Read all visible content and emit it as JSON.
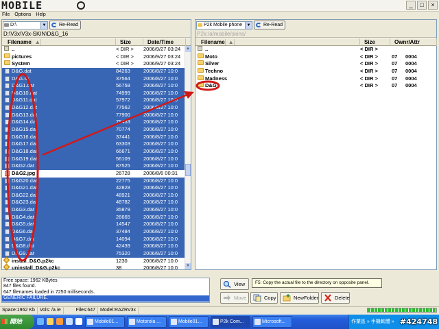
{
  "app": {
    "logo_text": "MOBILE",
    "window_buttons": [
      "_",
      "□",
      "×"
    ]
  },
  "menu": [
    "File",
    "Options",
    "Help"
  ],
  "left": {
    "drive": "D:\\",
    "reread": "Re-Read",
    "path": "D:\\V3x\\V3x-SKIN\\D&G_16",
    "columns": {
      "filename": "Filename",
      "size": "Size",
      "date": "Date/Time"
    },
    "rows": [
      {
        "icon": "up",
        "name": "..",
        "size": "< DIR >",
        "date": "2006/9/27 03:24",
        "sel": false
      },
      {
        "icon": "folder",
        "name": "pictures",
        "size": "< DIR >",
        "date": "2006/9/27 03:24",
        "sel": false
      },
      {
        "icon": "folder",
        "name": "System",
        "size": "< DIR >",
        "date": "2006/9/27 03:24",
        "sel": false
      },
      {
        "icon": "file",
        "name": "D&G.dat",
        "size": "84263",
        "date": "2006/8/27 10:0",
        "sel": true
      },
      {
        "icon": "file",
        "name": "D&G.sk",
        "size": "37564",
        "date": "2006/8/27 10:0",
        "sel": true
      },
      {
        "icon": "file",
        "name": "D&G1.dat",
        "size": "56758",
        "date": "2006/8/27 10:0",
        "sel": true
      },
      {
        "icon": "file",
        "name": "D&G10.dat",
        "size": "74999",
        "date": "2006/8/27 10:0",
        "sel": true
      },
      {
        "icon": "file",
        "name": "D&G11.dat",
        "size": "57972",
        "date": "2006/8/27 10:0",
        "sel": true
      },
      {
        "icon": "file",
        "name": "D&G12.dat",
        "size": "77562",
        "date": "2006/8/27 10:0",
        "sel": true
      },
      {
        "icon": "file",
        "name": "D&G13.dat",
        "size": "77900",
        "date": "2006/8/27 10:0",
        "sel": true
      },
      {
        "icon": "file",
        "name": "D&G14.dat",
        "size": "75433",
        "date": "2006/8/27 10:0",
        "sel": true
      },
      {
        "icon": "file",
        "name": "D&G15.dat",
        "size": "70774",
        "date": "2006/8/27 10:0",
        "sel": true
      },
      {
        "icon": "file",
        "name": "D&G16.dat",
        "size": "37441",
        "date": "2006/8/27 10:0",
        "sel": true
      },
      {
        "icon": "file",
        "name": "D&G17.dat",
        "size": "63303",
        "date": "2006/8/27 10:0",
        "sel": true
      },
      {
        "icon": "file",
        "name": "D&G18.dat",
        "size": "66671",
        "date": "2006/8/27 10:0",
        "sel": true
      },
      {
        "icon": "file",
        "name": "D&G19.dat",
        "size": "56109",
        "date": "2006/8/27 10:0",
        "sel": true
      },
      {
        "icon": "file",
        "name": "D&G2.dat",
        "size": "87525",
        "date": "2006/8/27 10:0",
        "sel": true
      },
      {
        "icon": "img",
        "name": "D&G2.jpg",
        "size": "26728",
        "date": "2006/8/6 00:31",
        "sel": false
      },
      {
        "icon": "file",
        "name": "D&G20.dat",
        "size": "22775",
        "date": "2006/8/27 10:0",
        "sel": true
      },
      {
        "icon": "file",
        "name": "D&G21.dat",
        "size": "42828",
        "date": "2006/8/27 10:0",
        "sel": true
      },
      {
        "icon": "file",
        "name": "D&G22.dat",
        "size": "48921",
        "date": "2006/8/27 10:0",
        "sel": true
      },
      {
        "icon": "file",
        "name": "D&G23.dat",
        "size": "48782",
        "date": "2006/8/27 10:0",
        "sel": true
      },
      {
        "icon": "file",
        "name": "D&G3.dat",
        "size": "35879",
        "date": "2006/8/27 10:0",
        "sel": true
      },
      {
        "icon": "file",
        "name": "D&G4.dat",
        "size": "26665",
        "date": "2006/8/27 10:0",
        "sel": true
      },
      {
        "icon": "file",
        "name": "D&G5.dat",
        "size": "14547",
        "date": "2006/8/27 10:0",
        "sel": true
      },
      {
        "icon": "file",
        "name": "D&G6.dat",
        "size": "37484",
        "date": "2006/8/27 10:0",
        "sel": true
      },
      {
        "icon": "file",
        "name": "D&G7.dat",
        "size": "14094",
        "date": "2006/8/27 10:0",
        "sel": true
      },
      {
        "icon": "file",
        "name": "D&G8.dat",
        "size": "42439",
        "date": "2006/8/27 10:0",
        "sel": true
      },
      {
        "icon": "file",
        "name": "D&G9.dat",
        "size": "75320",
        "date": "2006/8/27 10:0",
        "sel": true
      },
      {
        "icon": "pkg",
        "name": "install_D&G.p2kc",
        "size": "1230",
        "date": "2006/8/27 10:0",
        "sel": false
      },
      {
        "icon": "pkg",
        "name": "uninstall_D&G.p2kc",
        "size": "38",
        "date": "2006/8/27 10:0",
        "sel": false
      }
    ]
  },
  "right": {
    "drive": "P2k Mobile phone",
    "reread": "Re-Read",
    "path": "P2k:/a/mobile/skins/",
    "columns": {
      "filename": "Filename",
      "size": "Size",
      "owner": "Ownr/Attr"
    },
    "rows": [
      {
        "icon": "up",
        "name": "..",
        "size": "< DIR >",
        "owner": "",
        "attr": ""
      },
      {
        "icon": "folder",
        "name": "Moto",
        "size": "< DIR >",
        "owner": "07",
        "attr": "0004"
      },
      {
        "icon": "folder",
        "name": "Silver",
        "size": "< DIR >",
        "owner": "07",
        "attr": "0004"
      },
      {
        "icon": "folder",
        "name": "Techno",
        "size": "< DIR >",
        "owner": "07",
        "attr": "0004"
      },
      {
        "icon": "folder",
        "name": "Madness",
        "size": "< DIR >",
        "owner": "07",
        "attr": "0004"
      },
      {
        "icon": "folder",
        "name": "D&G",
        "size": "< DIR >",
        "owner": "07",
        "attr": "0004"
      }
    ]
  },
  "log": [
    "Free space: 1962 KBytes",
    "847 files found.",
    "647 filenames loaded in 7250 milliseconds.",
    "GENERIC FAILURE."
  ],
  "actions": {
    "view": "View",
    "move": "Move",
    "copy": "Copy",
    "newfolder": "NewFolder",
    "delete": "Delete",
    "tooltip": "F5: Copy the actual file to the directory on opposite panel."
  },
  "status": {
    "space": "Space:1962 Kb",
    "vols": "Vols: /a /e",
    "files": "Files:647",
    "model": "Model:RAZRV3x"
  },
  "taskbar": {
    "start": "開始",
    "tasks": [
      {
        "label": "Mobile01...",
        "active": false
      },
      {
        "label": "Motorola ...",
        "active": false
      },
      {
        "label": "Mobile01...",
        "active": false
      },
      {
        "label": "P2k Com...",
        "active": true
      },
      {
        "label": "Microsoft...",
        "active": false
      }
    ],
    "tray_text": "作業區 » 手機軟體 »"
  },
  "watermark": "#424748"
}
